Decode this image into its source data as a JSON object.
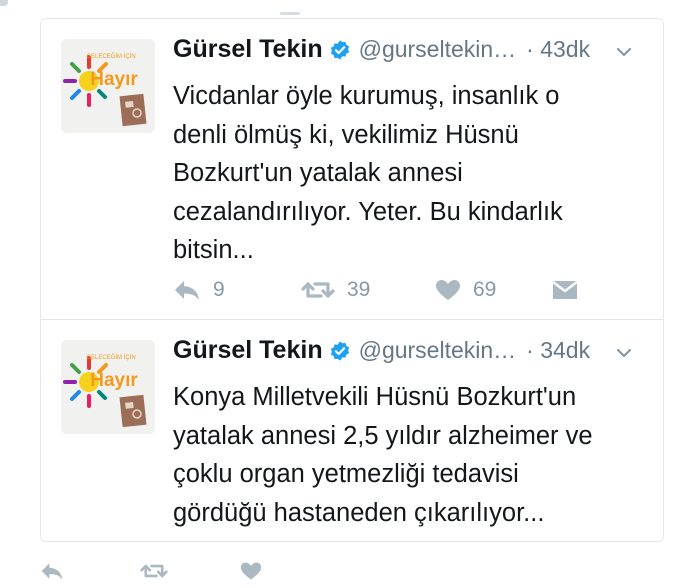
{
  "tweets": [
    {
      "name": "Gürsel Tekin",
      "handle": "@gurseltekin…",
      "time": "· 43dk",
      "text": "Vicdanlar öyle kurumuş, insanlık o denli ölmüş ki, vekilimiz Hüsnü Bozkurt'un yatalak annesi cezalandırılıyor. Yeter. Bu kindarlık bitsin...",
      "avatar": {
        "top_text": "GELECEĞİM İÇİN",
        "main_text": "Hayır"
      },
      "actions": {
        "replies": "9",
        "retweets": "39",
        "likes": "69"
      }
    },
    {
      "name": "Gürsel Tekin",
      "handle": "@gurseltekin…",
      "time": "· 34dk",
      "text": "Konya Milletvekili Hüsnü Bozkurt'un yatalak annesi 2,5 yıldır alzheimer ve çoklu organ yetmezliği tedavisi gördüğü hastaneden çıkarılıyor...",
      "avatar": {
        "top_text": "GELECEĞİM İÇİN",
        "main_text": "Hayır"
      }
    }
  ],
  "icons": {
    "reply": "reply-icon",
    "retweet": "retweet-icon",
    "like": "heart-icon",
    "dm": "envelope-icon",
    "verified": "verified-badge-icon",
    "caret": "chevron-down-icon"
  },
  "colors": {
    "verified": "#1da1f2",
    "icon_gray": "#aab8c2",
    "text_secondary": "#657786",
    "avatar_orange": "#f39a1e",
    "avatar_yellow": "#f7d21c"
  }
}
